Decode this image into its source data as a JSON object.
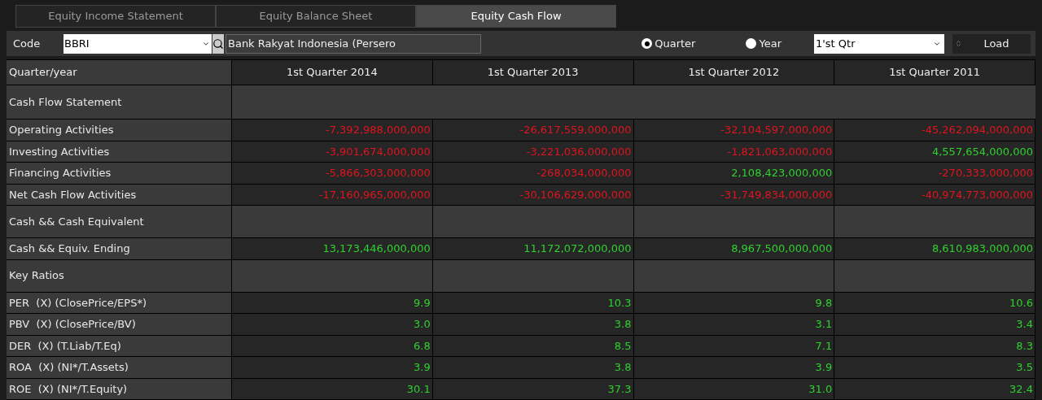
{
  "tabs": [
    {
      "label": "Equity Income Statement",
      "selected": false
    },
    {
      "label": "Equity Balance Sheet",
      "selected": false
    },
    {
      "label": "Equity Cash Flow",
      "selected": true
    }
  ],
  "toolbar": {
    "code_label": "Code",
    "code_value": "BBRI",
    "company_name": "Bank Rakyat Indonesia (Persero",
    "periods": [
      {
        "label": "Quarter",
        "selected": true
      },
      {
        "label": "Year",
        "selected": false
      }
    ],
    "period_select": "1'st Qtr",
    "load_button": "Load"
  },
  "table": {
    "columns": [
      "Quarter/year",
      "1st Quarter 2014",
      "1st Quarter 2013",
      "1st Quarter 2012",
      "1st Quarter 2011"
    ],
    "rows": [
      {
        "kind": "title",
        "label": "Cash Flow Statement"
      },
      {
        "kind": "value",
        "label": "Operating Activities",
        "cells": [
          {
            "text": "-7,392,988,000,000",
            "color": "#e0141e"
          },
          {
            "text": "-26,617,559,000,000",
            "color": "#e0141e"
          },
          {
            "text": "-32,104,597,000,000",
            "color": "#e0141e"
          },
          {
            "text": "-45,262,094,000,000",
            "color": "#e0141e"
          }
        ]
      },
      {
        "kind": "value",
        "label": "Investing Activities",
        "cells": [
          {
            "text": "-3,901,674,000,000",
            "color": "#e0141e"
          },
          {
            "text": "-3,221,036,000,000",
            "color": "#e0141e"
          },
          {
            "text": "-1,821,063,000,000",
            "color": "#e0141e"
          },
          {
            "text": "4,557,654,000,000",
            "color": "#2fd12f"
          }
        ]
      },
      {
        "kind": "value",
        "label": "Financing Activities",
        "cells": [
          {
            "text": "-5,866,303,000,000",
            "color": "#e0141e"
          },
          {
            "text": "-268,034,000,000",
            "color": "#e0141e"
          },
          {
            "text": "2,108,423,000,000",
            "color": "#2fd12f"
          },
          {
            "text": "-270,333,000,000",
            "color": "#e0141e"
          }
        ]
      },
      {
        "kind": "value",
        "label": "Net Cash Flow Activities",
        "cells": [
          {
            "text": "-17,160,965,000,000",
            "color": "#e0141e"
          },
          {
            "text": "-30,106,629,000,000",
            "color": "#e0141e"
          },
          {
            "text": "-31,749,834,000,000",
            "color": "#e0141e"
          },
          {
            "text": "-40,974,773,000,000",
            "color": "#e0141e"
          }
        ]
      },
      {
        "kind": "section",
        "label": "Cash && Cash Equivalent"
      },
      {
        "kind": "value",
        "label": "Cash && Equiv. Ending",
        "cells": [
          {
            "text": "13,173,446,000,000",
            "color": "#2fd12f"
          },
          {
            "text": "11,172,072,000,000",
            "color": "#2fd12f"
          },
          {
            "text": "8,967,500,000,000",
            "color": "#2fd12f"
          },
          {
            "text": "8,610,983,000,000",
            "color": "#2fd12f"
          }
        ]
      },
      {
        "kind": "section",
        "label": "Key Ratios"
      },
      {
        "kind": "value",
        "label": "PER  (X) (ClosePrice/EPS*)",
        "cells": [
          {
            "text": "9.9",
            "color": "#2fd12f"
          },
          {
            "text": "10.3",
            "color": "#2fd12f"
          },
          {
            "text": "9.8",
            "color": "#2fd12f"
          },
          {
            "text": "10.6",
            "color": "#2fd12f"
          }
        ]
      },
      {
        "kind": "value",
        "label": "PBV  (X) (ClosePrice/BV)",
        "cells": [
          {
            "text": "3.0",
            "color": "#2fd12f"
          },
          {
            "text": "3.8",
            "color": "#2fd12f"
          },
          {
            "text": "3.1",
            "color": "#2fd12f"
          },
          {
            "text": "3.4",
            "color": "#2fd12f"
          }
        ]
      },
      {
        "kind": "value",
        "label": "DER  (X) (T.Liab/T.Eq)",
        "cells": [
          {
            "text": "6.8",
            "color": "#2fd12f"
          },
          {
            "text": "8.5",
            "color": "#2fd12f"
          },
          {
            "text": "7.1",
            "color": "#2fd12f"
          },
          {
            "text": "8.3",
            "color": "#2fd12f"
          }
        ]
      },
      {
        "kind": "value",
        "label": "ROA  (X) (NI*/T.Assets)",
        "cells": [
          {
            "text": "3.9",
            "color": "#2fd12f"
          },
          {
            "text": "3.8",
            "color": "#2fd12f"
          },
          {
            "text": "3.9",
            "color": "#2fd12f"
          },
          {
            "text": "3.5",
            "color": "#2fd12f"
          }
        ]
      },
      {
        "kind": "value",
        "label": "ROE  (X) (NI*/T.Equity)",
        "cells": [
          {
            "text": "30.1",
            "color": "#2fd12f"
          },
          {
            "text": "37.3",
            "color": "#2fd12f"
          },
          {
            "text": "31.0",
            "color": "#2fd12f"
          },
          {
            "text": "32.4",
            "color": "#2fd12f"
          }
        ]
      }
    ]
  }
}
